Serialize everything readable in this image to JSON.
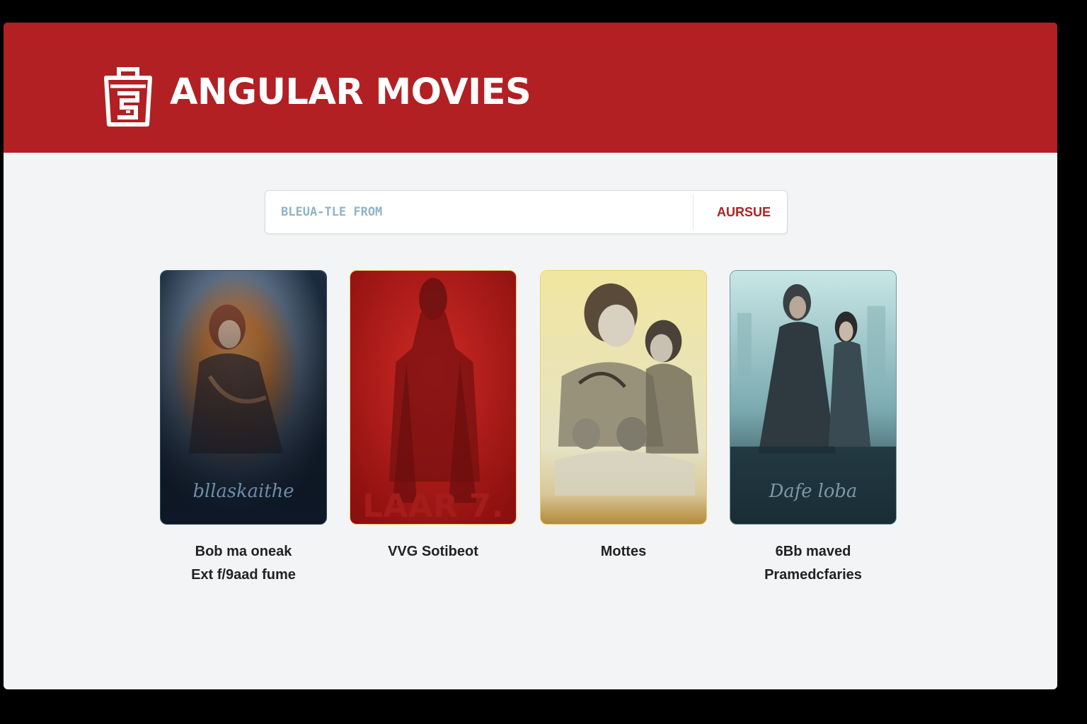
{
  "header": {
    "brand": "ANGULAR MOVIES",
    "background_color": "#b22024",
    "logo_icon": "shopping-bag-logo-icon"
  },
  "search": {
    "placeholder": "BLEUA-TLE FROM",
    "button_label": "AURSUE"
  },
  "movies": [
    {
      "title_lines": [
        "Bob ma oneak",
        "Ext f/9aad fume"
      ],
      "poster_text": "bllaskaithe",
      "palette": "blue-fire"
    },
    {
      "title_lines": [
        "VVG Sotibeot",
        ""
      ],
      "poster_text": "LAAR 7.",
      "palette": "red"
    },
    {
      "title_lines": [
        "Mottes",
        ""
      ],
      "poster_text": "",
      "palette": "yellow-sepia"
    },
    {
      "title_lines": [
        "6Bb maved",
        "Pramedcfaries"
      ],
      "poster_text": "Dafe loba",
      "palette": "teal"
    }
  ]
}
